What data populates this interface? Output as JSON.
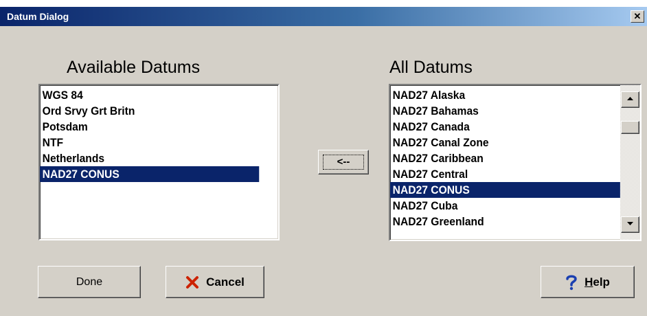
{
  "window": {
    "title": "Datum Dialog",
    "close_glyph": "✕"
  },
  "available": {
    "heading": "Available Datums",
    "items": [
      "WGS 84",
      "Ord Srvy Grt Britn",
      "Potsdam",
      "NTF",
      "Netherlands",
      "NAD27 CONUS"
    ],
    "selected_index": 5
  },
  "all": {
    "heading": "All Datums",
    "items": [
      "NAD27 Alaska",
      "NAD27 Bahamas",
      "NAD27 Canada",
      "NAD27 Canal Zone",
      "NAD27 Caribbean",
      "NAD27 Central",
      "NAD27 CONUS",
      "NAD27 Cuba",
      "NAD27 Greenland"
    ],
    "selected_index": 6
  },
  "buttons": {
    "move_label": "<--",
    "done_label": "Done",
    "cancel_label": "Cancel",
    "help_label": "Help",
    "help_mnemonic": "H",
    "help_rest": "elp"
  },
  "icons": {
    "close": "close-icon",
    "cancel": "red-x-icon",
    "help": "question-mark-icon",
    "scroll_up": "arrow-up-icon",
    "scroll_down": "arrow-down-icon"
  },
  "colors": {
    "selection": "#0a246a",
    "face": "#d4d0c8",
    "cancel_icon": "#cc2200",
    "help_icon": "#1a3fb0"
  }
}
